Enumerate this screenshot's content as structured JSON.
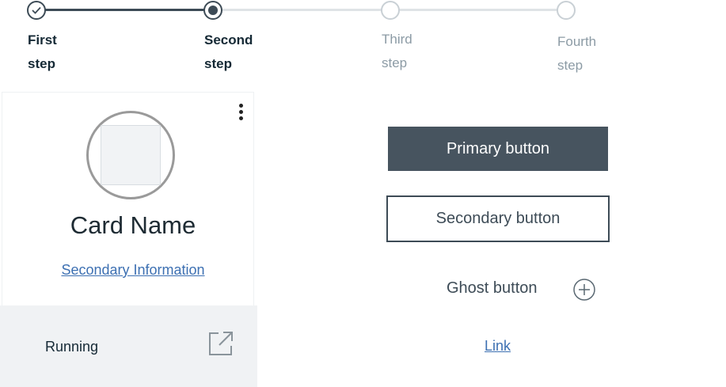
{
  "progress": {
    "steps": [
      {
        "line1": "First",
        "line2": "step",
        "state": "complete"
      },
      {
        "line1": "Second",
        "line2": "step",
        "state": "current"
      },
      {
        "line1": "Third",
        "line2": "step",
        "state": "incomplete"
      },
      {
        "line1": "Fourth",
        "line2": "step",
        "state": "incomplete"
      }
    ]
  },
  "card": {
    "name": "Card Name",
    "secondary_info": "Secondary Information",
    "status": "Running",
    "menu_icon": "overflow-menu-vertical-icon",
    "launch_icon": "launch-icon"
  },
  "buttons": {
    "primary": "Primary button",
    "secondary": "Secondary button",
    "ghost": "Ghost button",
    "ghost_icon": "add-circle-icon",
    "link": "Link"
  },
  "colors": {
    "primary_bg": "#47545f",
    "text_dark": "#152935",
    "link": "#3d70b2",
    "step_inactive_text": "#8c9ba5",
    "step_track_inactive": "#dfe3e6",
    "card_footer_bg": "#f0f2f4"
  }
}
